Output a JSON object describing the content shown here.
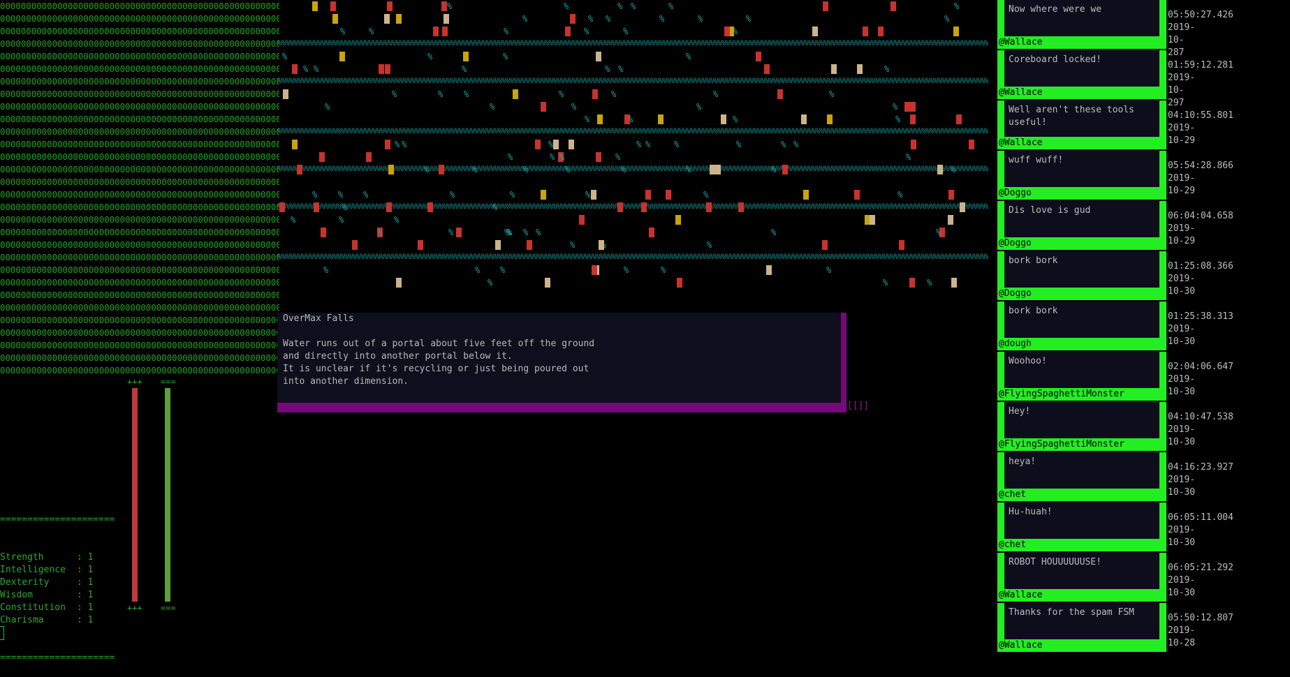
{
  "terrain": {
    "glyph_row": "000000000000000000000000000000000000000000000000000000000",
    "row_count": 30
  },
  "popup": {
    "title": "OverMax Falls",
    "description_lines": [
      "Water runs out of a portal about five feet off the ground",
      "and directly into another portal below it.",
      "It is unclear if it's recycling or just being poured out",
      "into another dimension."
    ],
    "corner_marker": "[[]]"
  },
  "bars": {
    "health": {
      "top_label": "+++",
      "bottom_label": "+++",
      "color": "#c03a3a",
      "level": 1.0
    },
    "mana": {
      "top_label": "===",
      "bottom_label": "===",
      "color": "#5e9e3c",
      "level": 1.0
    }
  },
  "stats": {
    "divider": "=====================",
    "items": [
      {
        "name": "Strength",
        "value": "1"
      },
      {
        "name": "Intelligence",
        "value": "1"
      },
      {
        "name": "Dexterity",
        "value": "1"
      },
      {
        "name": "Wisdom",
        "value": "1"
      },
      {
        "name": "Constitution",
        "value": "1"
      },
      {
        "name": "Charisma",
        "value": "1"
      }
    ]
  },
  "chat": {
    "messages": [
      {
        "text": "Now where were we",
        "user": "@Wallace",
        "time": "05:50:27.426",
        "date": "2019-10-287"
      },
      {
        "text": "Coreboard locked!",
        "user": "@Wallace",
        "time": "01:59:12.281",
        "date": "2019-10-297"
      },
      {
        "text": "Well aren't these tools useful!",
        "user": "@Wallace",
        "time": "04:10:55.801",
        "date": "2019-10-29"
      },
      {
        "text": "wuff wuff!",
        "user": "@Doggo",
        "time": "05:54:28.866",
        "date": "2019-10-29"
      },
      {
        "text": "Dis love is gud",
        "user": "@Doggo",
        "time": "06:04:04.658",
        "date": "2019-10-29"
      },
      {
        "text": "bork bork",
        "user": "@Doggo",
        "time": "01:25:08.366",
        "date": "2019-10-30"
      },
      {
        "text": "bork bork",
        "user": "@dough",
        "time": "01:25:38.313",
        "date": "2019-10-30"
      },
      {
        "text": "Woohoo!",
        "user": "@FlyingSpaghettiMonster",
        "time": "02:04:06.647",
        "date": "2019-10-30"
      },
      {
        "text": "Hey!",
        "user": "@FlyingSpaghettiMonster",
        "time": "04:10:47.538",
        "date": "2019-10-30"
      },
      {
        "text": "heya!",
        "user": "@chet",
        "time": "04:16:23.927",
        "date": "2019-10-30"
      },
      {
        "text": "Hu-huah!",
        "user": "@chet",
        "time": "06:05:11.004",
        "date": "2019-10-30"
      },
      {
        "text": "ROBOT HOUUUUUUSE!",
        "user": "@Wallace",
        "time": "06:05:21.292",
        "date": "2019-10-30"
      },
      {
        "text": "Thanks for the spam FSM",
        "user": "@Wallace",
        "time": "05:50:12.807",
        "date": "2019-10-28"
      }
    ]
  },
  "map": {
    "hall_glyph": "%",
    "colors": {
      "hall": "#169a9a",
      "red_item": "#c8332d",
      "tan_item": "#cdb38c",
      "gold_item": "#c9a50a"
    }
  }
}
